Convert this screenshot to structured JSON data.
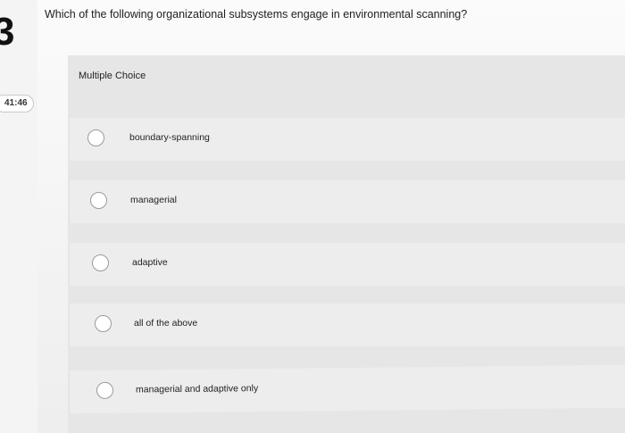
{
  "question": {
    "number": "3",
    "text": "Which of the following organizational subsystems engage in environmental scanning?"
  },
  "timer": {
    "value": "41:46"
  },
  "section": {
    "label": "Multiple Choice"
  },
  "options": [
    {
      "label": "boundary-spanning"
    },
    {
      "label": "managerial"
    },
    {
      "label": "adaptive"
    },
    {
      "label": "all of the above"
    },
    {
      "label": "managerial and adaptive only"
    }
  ],
  "icons": {
    "radio": "radio-unselected-icon"
  },
  "colors": {
    "panel": "#e6e6e6",
    "option_row": "#ededed",
    "radio_border": "#9a9a9a"
  }
}
